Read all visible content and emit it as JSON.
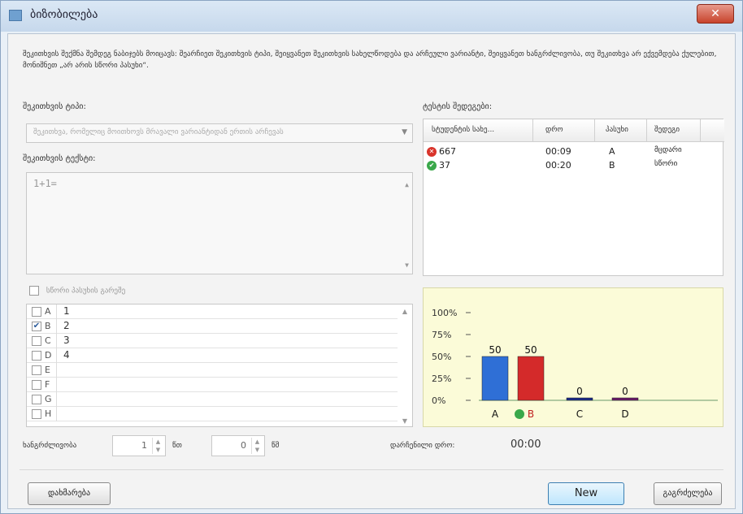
{
  "window": {
    "title": "ბიზობილება",
    "close_label": "✕"
  },
  "description": "შეკითხვის შექმნა შემდეგ ნაბიჯებს მოიცავს: შეარჩიეთ შეკითხვის ტიპი, შეიყვანეთ შეკითხვის სახელწოდება და არჩეული ვარიანტი, შეიყვანეთ ხანგრძლივობა, თუ შეკითხვა არ ექვემდება ქულებით, მონიშნეთ „არ არის სწორი პასუხი“.",
  "question_type": {
    "label": "შეკითხვის ტიპი:",
    "value": "შეკითხვა, რომელიც მოითხოვს მრავალი ვარიანტიდან ერთის არჩევას",
    "arrow": "▼"
  },
  "question_text": {
    "label": "შეკითხვის ტექსტი:",
    "value": "1+1="
  },
  "no_correct": {
    "label": "სწორი პასუხის გარეშე"
  },
  "answers": [
    {
      "letter": "A",
      "text": "1",
      "checked": false
    },
    {
      "letter": "B",
      "text": "2",
      "checked": true
    },
    {
      "letter": "C",
      "text": "3",
      "checked": false
    },
    {
      "letter": "D",
      "text": "4",
      "checked": false
    },
    {
      "letter": "E",
      "text": "",
      "checked": false
    },
    {
      "letter": "F",
      "text": "",
      "checked": false
    },
    {
      "letter": "G",
      "text": "",
      "checked": false
    },
    {
      "letter": "H",
      "text": "",
      "checked": false
    }
  ],
  "results": {
    "label": "ტესტის შედეგები:",
    "columns": [
      "სტუდენტის სახე...",
      "დრო",
      "პასუხი",
      "შედეგი"
    ],
    "rows": [
      {
        "status": "wrong",
        "student": "667",
        "time": "00:09",
        "answer": "A",
        "result": "მცდარი"
      },
      {
        "status": "correct",
        "student": "37",
        "time": "00:20",
        "answer": "B",
        "result": "სწორი"
      }
    ]
  },
  "chart_data": {
    "type": "bar",
    "categories": [
      "A",
      "B",
      "C",
      "D"
    ],
    "values": [
      50,
      50,
      0,
      0
    ],
    "ylim": [
      0,
      100
    ],
    "yticks": [
      "0%",
      "25%",
      "50%",
      "75%",
      "100%"
    ],
    "correct_category": "B",
    "bar_colors": [
      "#2f6fd6",
      "#d42a2a",
      "#1a2a8a",
      "#6a1a6a"
    ]
  },
  "duration": {
    "label": "ხანგრძლივობა",
    "minutes": "1",
    "minutes_unit": "წთ",
    "seconds": "0",
    "seconds_unit": "წმ"
  },
  "elapsed": {
    "label": "დარჩენილი დრო:",
    "value": "00:00"
  },
  "buttons": {
    "save": "დახმარება",
    "new": "New",
    "close": "გაგრძელება"
  },
  "colors": {
    "wrong": "#d9342b",
    "correct": "#3aa84a"
  }
}
